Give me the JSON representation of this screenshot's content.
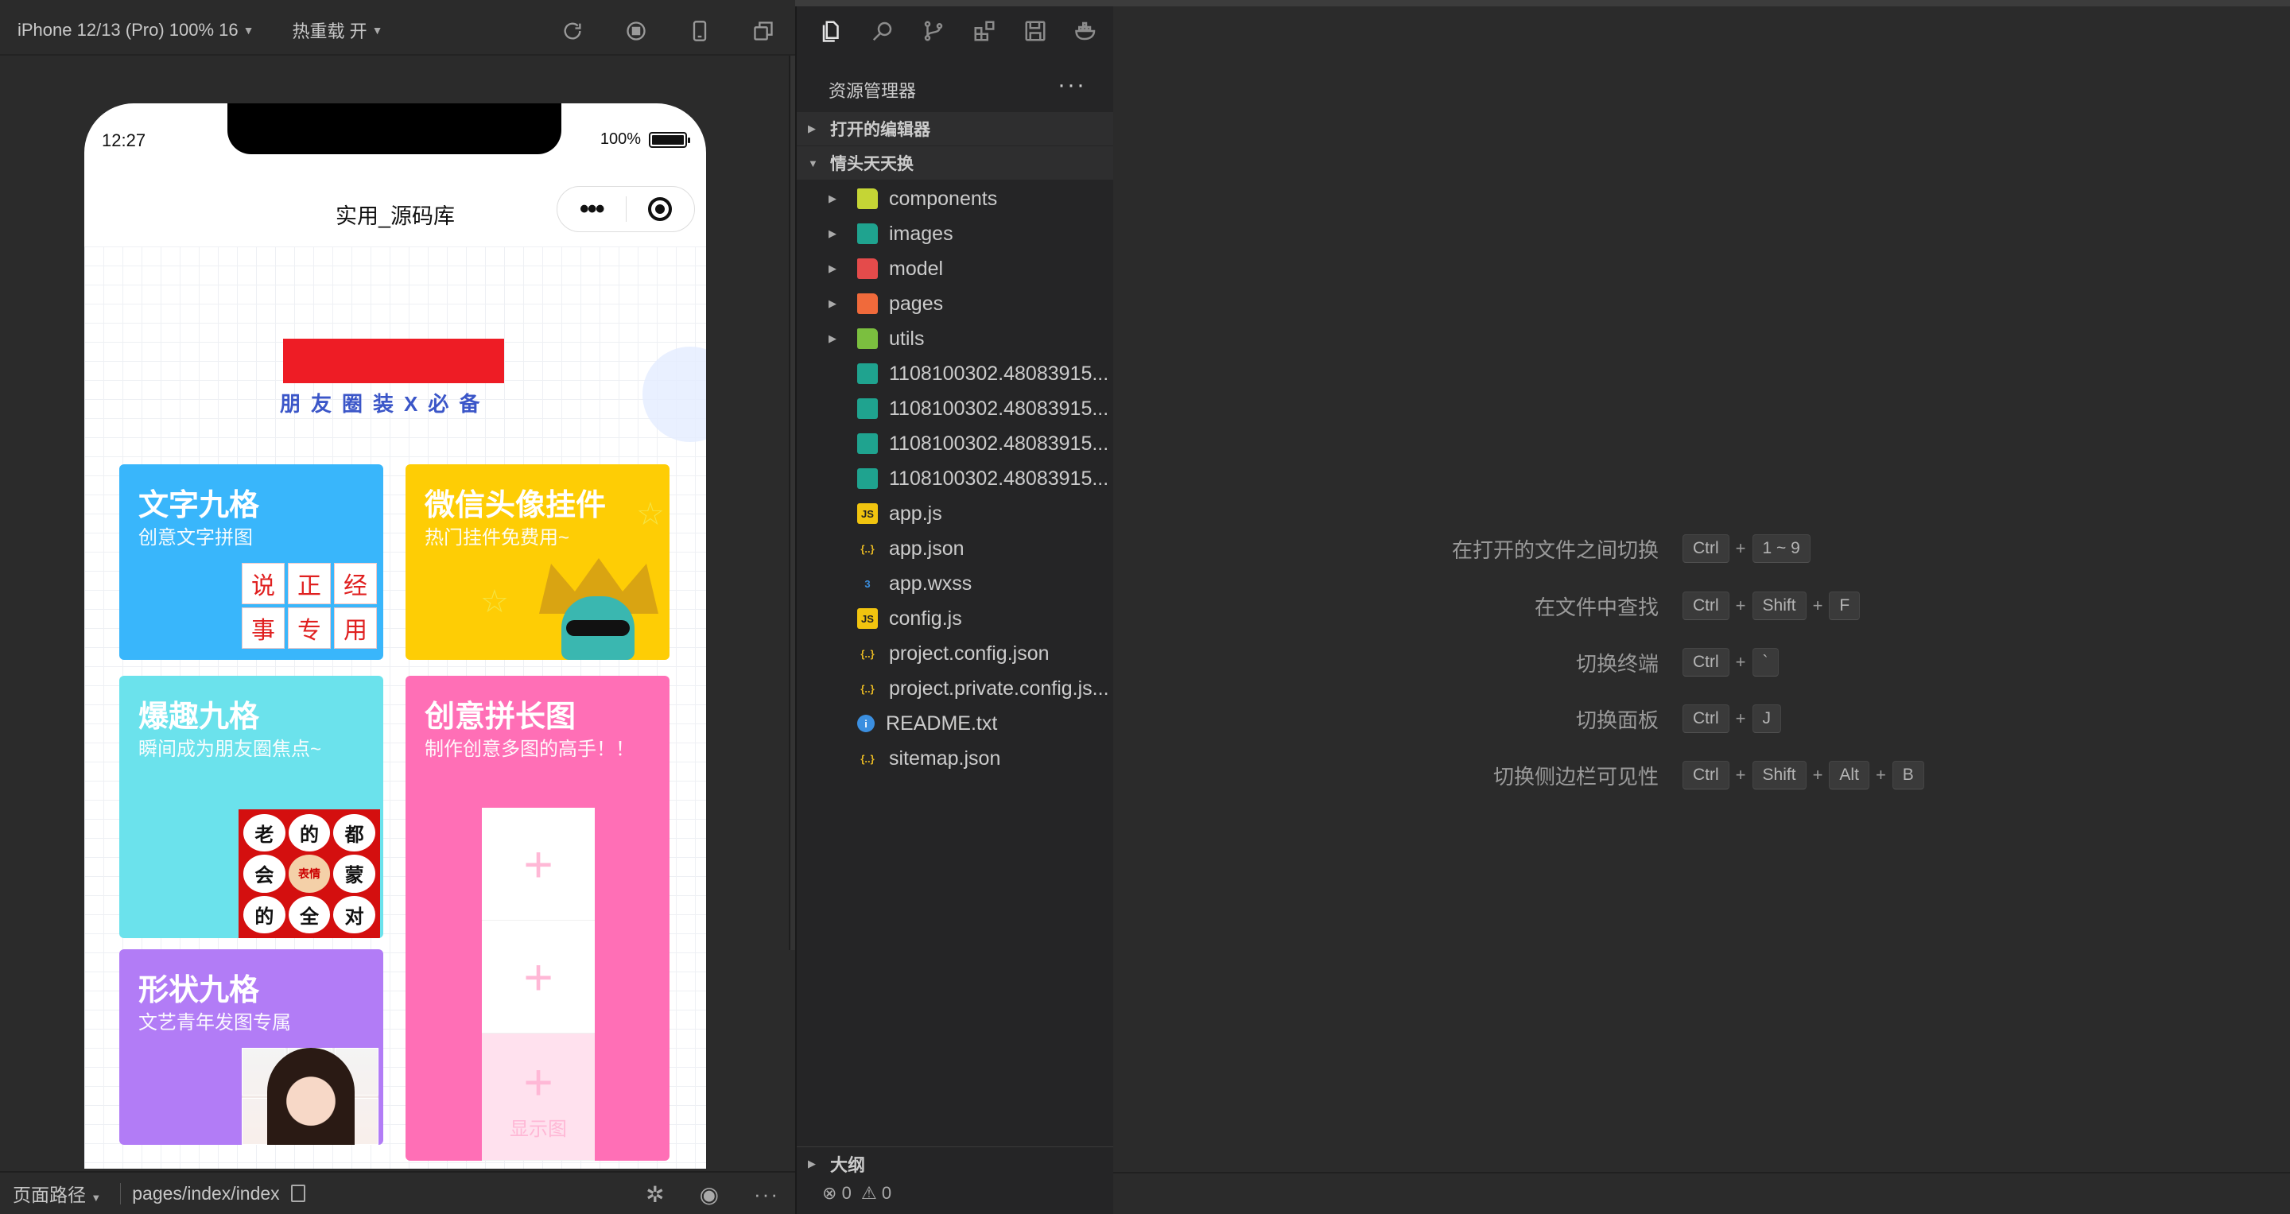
{
  "simulator": {
    "device": "iPhone 12/13 (Pro) 100% 16",
    "hot_reload": "热重载 开",
    "toolbar_icons": [
      "refresh-icon",
      "stop-icon",
      "phone-icon",
      "popout-icon"
    ],
    "status_time": "12:27",
    "battery": "100%",
    "nav_title": "实用_源码库",
    "banner_text": "朋友圈装X必备",
    "cards": [
      {
        "title": "文字九格",
        "subtitle": "创意文字拼图",
        "grid": [
          "说",
          "正",
          "经",
          "事",
          "专",
          "用"
        ]
      },
      {
        "title": "微信头像挂件",
        "subtitle": "热门挂件免费用~"
      },
      {
        "title": "爆趣九格",
        "subtitle": "瞬间成为朋友圈焦点~",
        "grid": [
          "老",
          "的",
          "都",
          "会",
          "表情",
          "蒙",
          "的",
          "全",
          "对"
        ]
      },
      {
        "title": "创意拼长图",
        "subtitle": "制作创意多图的高手！！",
        "placeholder_label": "显示图"
      },
      {
        "title": "形状九格",
        "subtitle": "文艺青年发图专属"
      }
    ],
    "bottom": {
      "page_path_label": "页面路径",
      "page_path": "pages/index/index"
    }
  },
  "explorer": {
    "title": "资源管理器",
    "more": "···",
    "section_open_editors": "打开的编辑器",
    "section_project": "情头天天换",
    "items": [
      {
        "label": "components",
        "kind": "folder",
        "color": "#c5d535",
        "badge": ""
      },
      {
        "label": "images",
        "kind": "folder",
        "color": "#1fa38f",
        "badge": ""
      },
      {
        "label": "model",
        "kind": "folder",
        "color": "#e44b4b",
        "badge": ""
      },
      {
        "label": "pages",
        "kind": "folder",
        "color": "#f06a3b",
        "badge": ""
      },
      {
        "label": "utils",
        "kind": "folder",
        "color": "#7bbf3f",
        "badge": ""
      },
      {
        "label": "1108100302.48083915...",
        "kind": "image",
        "color": "#1fa38f",
        "badge": ""
      },
      {
        "label": "1108100302.48083915...",
        "kind": "image",
        "color": "#1fa38f",
        "badge": ""
      },
      {
        "label": "1108100302.48083915...",
        "kind": "image",
        "color": "#1fa38f",
        "badge": ""
      },
      {
        "label": "1108100302.48083915...",
        "kind": "image",
        "color": "#1fa38f",
        "badge": ""
      },
      {
        "label": "app.js",
        "kind": "js",
        "color": "#f1c40f",
        "badge": "JS"
      },
      {
        "label": "app.json",
        "kind": "json",
        "color": "#e8b923",
        "badge": "{..}"
      },
      {
        "label": "app.wxss",
        "kind": "css",
        "color": "#3b8fe0",
        "badge": "3"
      },
      {
        "label": "config.js",
        "kind": "js",
        "color": "#f1c40f",
        "badge": "JS"
      },
      {
        "label": "project.config.json",
        "kind": "json",
        "color": "#e8b923",
        "badge": "{..}"
      },
      {
        "label": "project.private.config.js...",
        "kind": "json",
        "color": "#e8b923",
        "badge": "{..}"
      },
      {
        "label": "README.txt",
        "kind": "info",
        "color": "#3b8fe0",
        "badge": "i"
      },
      {
        "label": "sitemap.json",
        "kind": "json",
        "color": "#e8b923",
        "badge": "{..}"
      }
    ],
    "section_outline": "大纲",
    "errors": "0",
    "warnings": "0"
  },
  "shortcuts": [
    {
      "label": "在打开的文件之间切换",
      "keys": [
        "Ctrl",
        "1 ~ 9"
      ]
    },
    {
      "label": "在文件中查找",
      "keys": [
        "Ctrl",
        "Shift",
        "F"
      ]
    },
    {
      "label": "切换终端",
      "keys": [
        "Ctrl",
        "`"
      ]
    },
    {
      "label": "切换面板",
      "keys": [
        "Ctrl",
        "J"
      ]
    },
    {
      "label": "切换侧边栏可见性",
      "keys": [
        "Ctrl",
        "Shift",
        "Alt",
        "B"
      ]
    }
  ]
}
